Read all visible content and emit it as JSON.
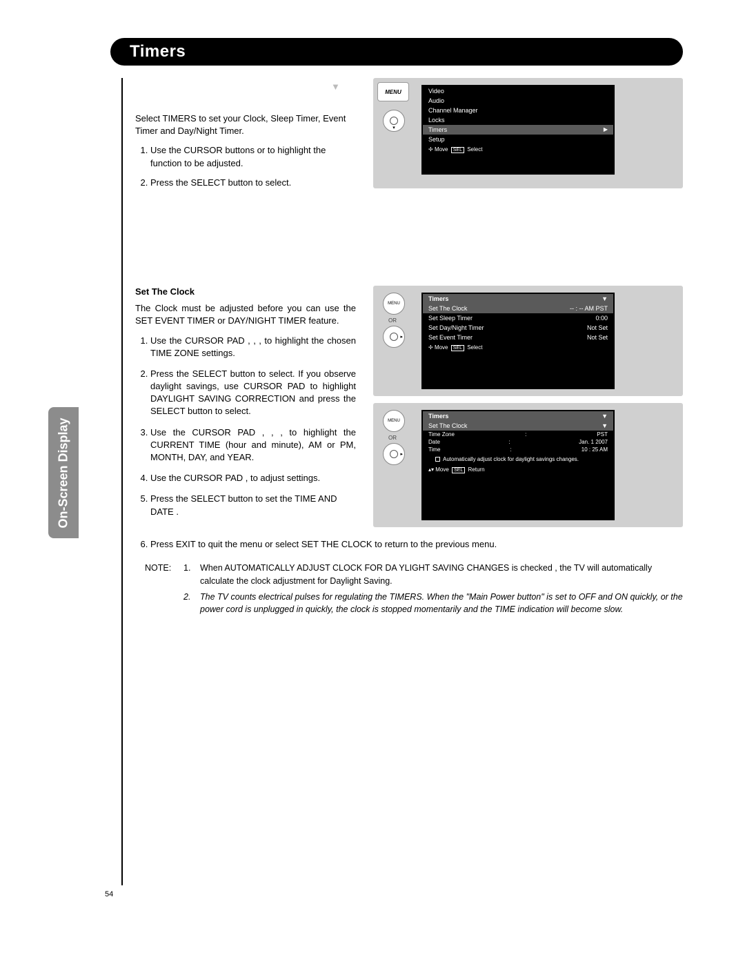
{
  "title": "Timers",
  "side_tab": "On-Screen Display",
  "page_number": "54",
  "intro": "Select TIMERS to set your Clock, Sleep Timer, Event Timer and Day/Night Timer.",
  "steps1": [
    "Use the CURSOR buttons      or      to highlight the function to be adjusted.",
    "Press the SELECT button to select."
  ],
  "set_clock": {
    "title": "Set The Clock",
    "desc": "The Clock must be adjusted before you can use the SET EVENT TIMER or DAY/NIGHT TIMER  feature.",
    "steps": [
      "Use  the  CURSOR  PAD     ,   ,   ,      to  highlight  the chosen TIME ZONE settings.",
      "Press the SELECT button to select. If you observe daylight savings, use CURSOR PAD to highlight DAYLIGHT SAVING CORRECTION and press the SELECT button to select.",
      "Use  the  CURSOR  PAD     ,   ,   ,      to  highlight the CURRENT TIME (hour and minute), AM or PM, MONTH, DAY, and YEAR.",
      "Use the CURSOR PAD    ,     to adjust settings.",
      "Press the SELECT button to set the TIME AND DATE .",
      "Press EXIT to quit the menu or select SET THE CLOCK to return to the previous menu."
    ]
  },
  "notes": {
    "label": "NOTE:",
    "items": [
      "When AUTOMATICALLY ADJUST CLOCK FOR DA YLIGHT SAVING CHANGES is checked     , the TV will automatically calculate the clock adjustment for Daylight Saving.",
      "The TV counts electrical pulses for regulating the    TIMERS. When the  \"Main Power button\" is set to OFF and ON quickly, or the power cord is unplugged in quickly, the clock is stopped momentarily and the     TIME indication will become slow."
    ]
  },
  "osd_main": {
    "menu_btn": "MENU",
    "items": [
      "Video",
      "Audio",
      "Channel Manager",
      "Locks",
      "Timers",
      "Setup"
    ],
    "footer_move": "Move",
    "footer_sel": "SEL",
    "footer_select": "Select"
  },
  "osd_timers": {
    "or": "OR",
    "header": "Timers",
    "rows": [
      {
        "k": "Set The Clock",
        "v": "-- : -- AM PST"
      },
      {
        "k": "Set Sleep Timer",
        "v": "0:00"
      },
      {
        "k": "Set Day/Night Timer",
        "v": "Not Set"
      },
      {
        "k": "Set Event Timer",
        "v": "Not Set"
      }
    ],
    "footer_move": "Move",
    "footer_sel": "SEL",
    "footer_select": "Select"
  },
  "osd_clock": {
    "or": "OR",
    "header": "Timers",
    "sub": "Set The Clock",
    "rows": [
      {
        "k": "Time Zone",
        "c": ":",
        "v": "PST"
      },
      {
        "k": "Date",
        "c": ":",
        "v": "Jan. 1 2007"
      },
      {
        "k": "Time",
        "c": ":",
        "v": "10 : 25 AM"
      }
    ],
    "checkbox": "Automatically adjust clock for daylight savings changes.",
    "footer_move": "Move",
    "footer_sel": "SEL",
    "footer_return": "Return"
  }
}
